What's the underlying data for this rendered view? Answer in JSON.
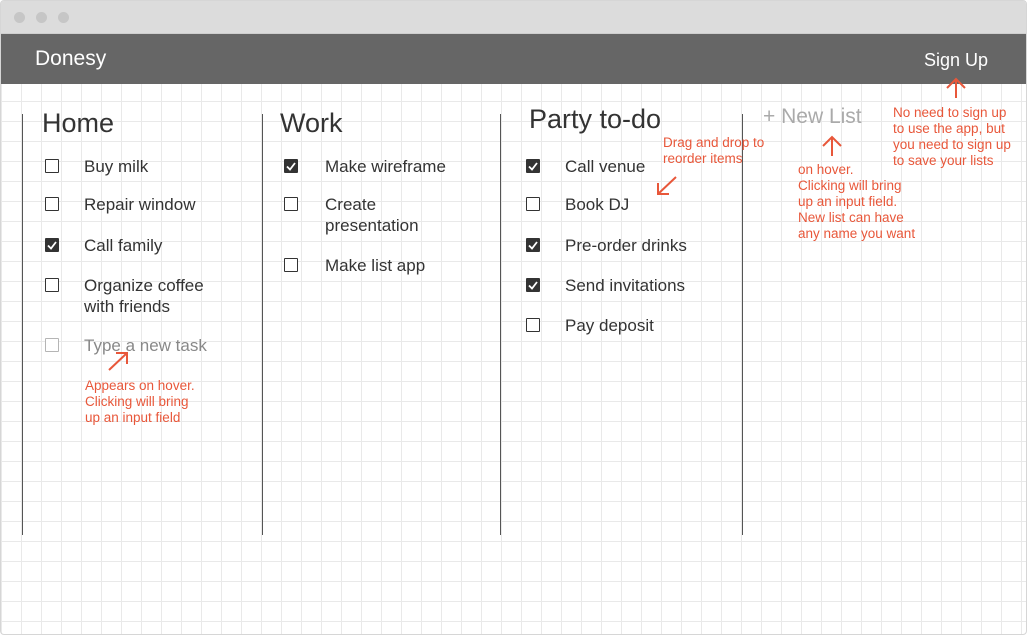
{
  "app": {
    "name": "Donesy",
    "signup_label": "Sign Up"
  },
  "lists": [
    {
      "title": "Home",
      "tasks": [
        {
          "label": "Buy milk",
          "checked": false
        },
        {
          "label": "Repair window",
          "checked": false
        },
        {
          "label": "Call family",
          "checked": true
        },
        {
          "label": "Organize coffee with friends",
          "checked": false
        }
      ],
      "new_task_placeholder": "Type a new task"
    },
    {
      "title": "Work",
      "tasks": [
        {
          "label": "Make wireframe",
          "checked": true
        },
        {
          "label": "Create presentation",
          "checked": false
        },
        {
          "label": "Make list app",
          "checked": false
        }
      ]
    },
    {
      "title": "Party to-do",
      "tasks": [
        {
          "label": "Call venue",
          "checked": true
        },
        {
          "label": "Book DJ",
          "checked": false
        },
        {
          "label": "Pre-order drinks",
          "checked": true
        },
        {
          "label": "Send invitations",
          "checked": true
        },
        {
          "label": "Pay deposit",
          "checked": false
        }
      ]
    }
  ],
  "new_list_label": "+ New List",
  "annotations": {
    "new_task": "Appears on hover.\nClicking will bring\nup an input field",
    "drag": "Drag and drop to\nreorder items",
    "new_list": "on hover.\nClicking will bring\nup an input field.\nNew list can have\nany name you want",
    "signup": "No need to sign up\nto use the app, but\nyou need to sign up\nto save your lists"
  },
  "colors": {
    "appbar": "#666666",
    "annotation": "#e8573a",
    "checkbox": "#333333"
  }
}
